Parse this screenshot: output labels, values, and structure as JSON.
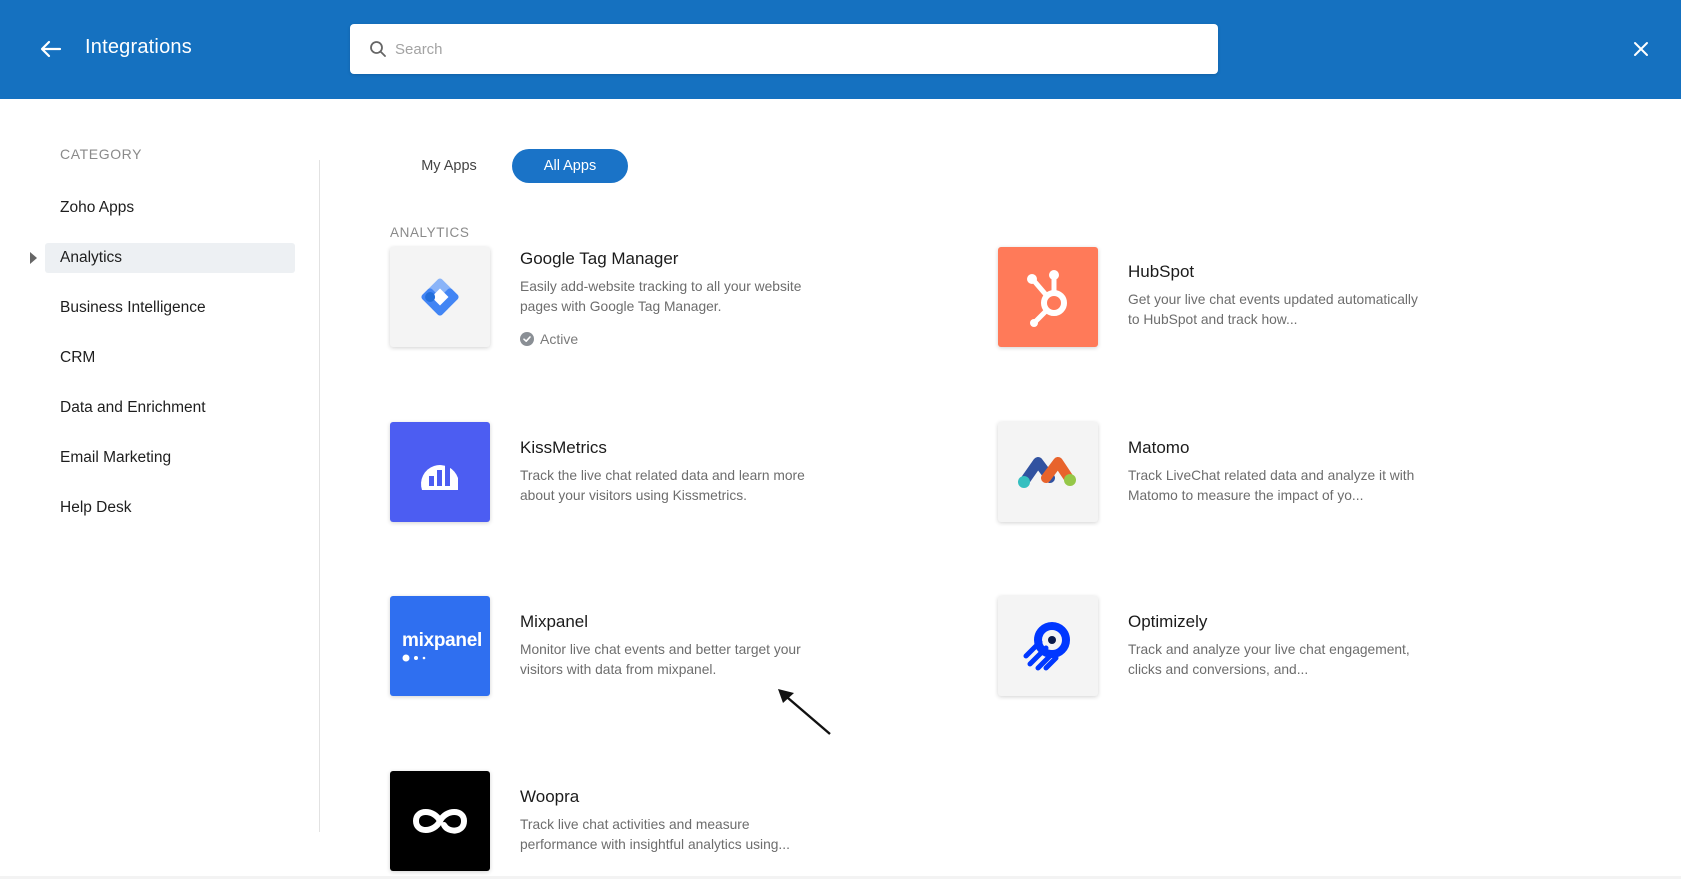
{
  "header": {
    "title": "Integrations",
    "search_placeholder": "Search",
    "back_icon": "arrow-left-icon",
    "close_icon": "close-icon",
    "color": "#1571c0"
  },
  "sidebar": {
    "heading": "CATEGORY",
    "items": [
      {
        "label": "Zoho Apps"
      },
      {
        "label": "Analytics",
        "active": true
      },
      {
        "label": "Business Intelligence"
      },
      {
        "label": "CRM"
      },
      {
        "label": "Data and Enrichment"
      },
      {
        "label": "Email Marketing"
      },
      {
        "label": "Help Desk"
      }
    ]
  },
  "tabs": {
    "my_apps": "My Apps",
    "all_apps": "All Apps",
    "selected": "All Apps",
    "accent": "#1a73c7"
  },
  "section": {
    "heading": "ANALYTICS"
  },
  "apps": [
    {
      "name": "Google Tag Manager",
      "desc": "Easily add-website tracking to all your website pages with Google Tag Manager.",
      "status": "Active",
      "logo_icon": "google-tag-manager-logo",
      "logo_bg": "#f4f4f4"
    },
    {
      "name": "HubSpot",
      "desc": "Get your live chat events updated automatically to HubSpot and track how...",
      "logo_icon": "hubspot-logo",
      "logo_bg": "#ff7a59"
    },
    {
      "name": "KissMetrics",
      "desc": "Track the live chat related data and learn more about your visitors using Kissmetrics.",
      "logo_icon": "kissmetrics-logo",
      "logo_bg": "#4c5df2"
    },
    {
      "name": "Matomo",
      "desc": "Track LiveChat related data and analyze it with Matomo to measure the impact of yo...",
      "logo_icon": "matomo-logo",
      "logo_bg": "#f4f4f4"
    },
    {
      "name": "Mixpanel",
      "desc": "Monitor live chat events and better target your visitors with data from mixpanel.",
      "logo_icon": "mixpanel-logo",
      "logo_text": "mixpanel",
      "logo_bg": "#2f6ff0"
    },
    {
      "name": "Optimizely",
      "desc": "Track and analyze your live chat engagement, clicks and conversions, and...",
      "logo_icon": "optimizely-logo",
      "logo_bg": "#f4f4f4"
    },
    {
      "name": "Woopra",
      "desc": "Track live chat activities and measure performance with insightful analytics using...",
      "logo_icon": "woopra-logo",
      "logo_bg": "#000000"
    }
  ]
}
